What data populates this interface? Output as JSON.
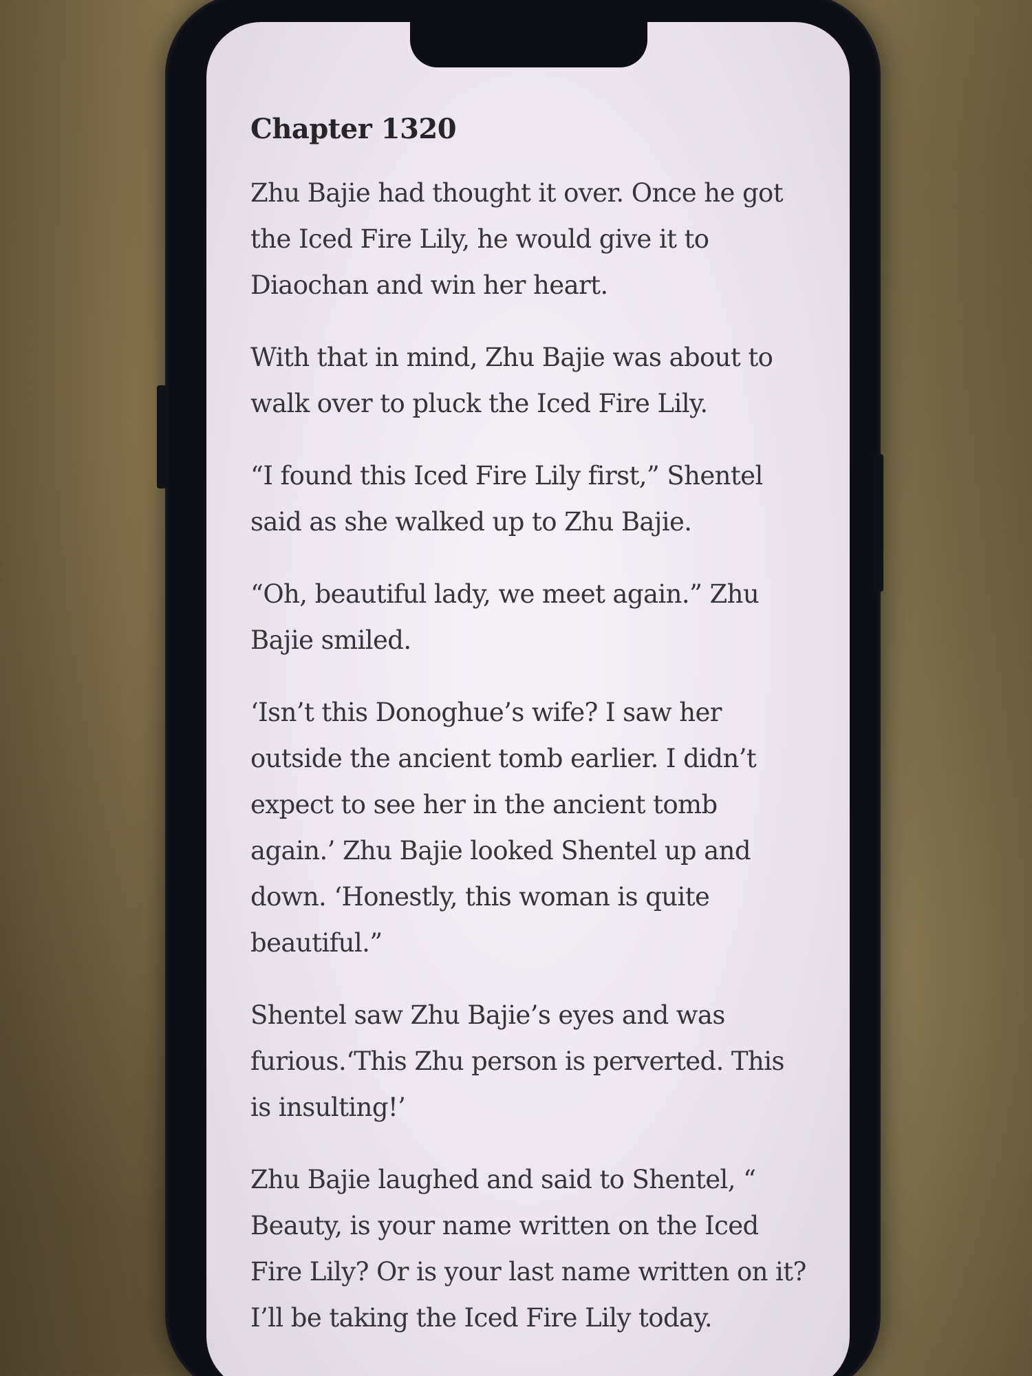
{
  "reader": {
    "chapter_title": "Chapter 1320",
    "paragraphs": [
      "Zhu Bajie had thought it over. Once he got the Iced Fire Lily, he would give it to Diaochan and win her heart.",
      "With that in mind, Zhu Bajie was about to walk over to pluck the Iced Fire Lily.",
      "“I found this Iced Fire Lily first,” Shentel said as she walked up to Zhu Bajie.",
      "“Oh, beautiful lady, we meet again.” Zhu Bajie smiled.",
      "‘Isn’t this Donoghue’s wife? I saw her outside the ancient tomb earlier. I didn’t expect to see her in the ancient tomb again.’ Zhu Bajie looked Shentel up and down. ‘Honestly, this woman is quite beautiful.”",
      "Shentel saw Zhu Bajie’s eyes and was furious.‘This Zhu person is perverted. This is insulting!’",
      "Zhu Bajie laughed and said to Shentel, “ Beauty, is your name written on the Iced Fire Lily? Or is your last name written on it? I’ll be taking the Iced Fire Lily today."
    ]
  }
}
